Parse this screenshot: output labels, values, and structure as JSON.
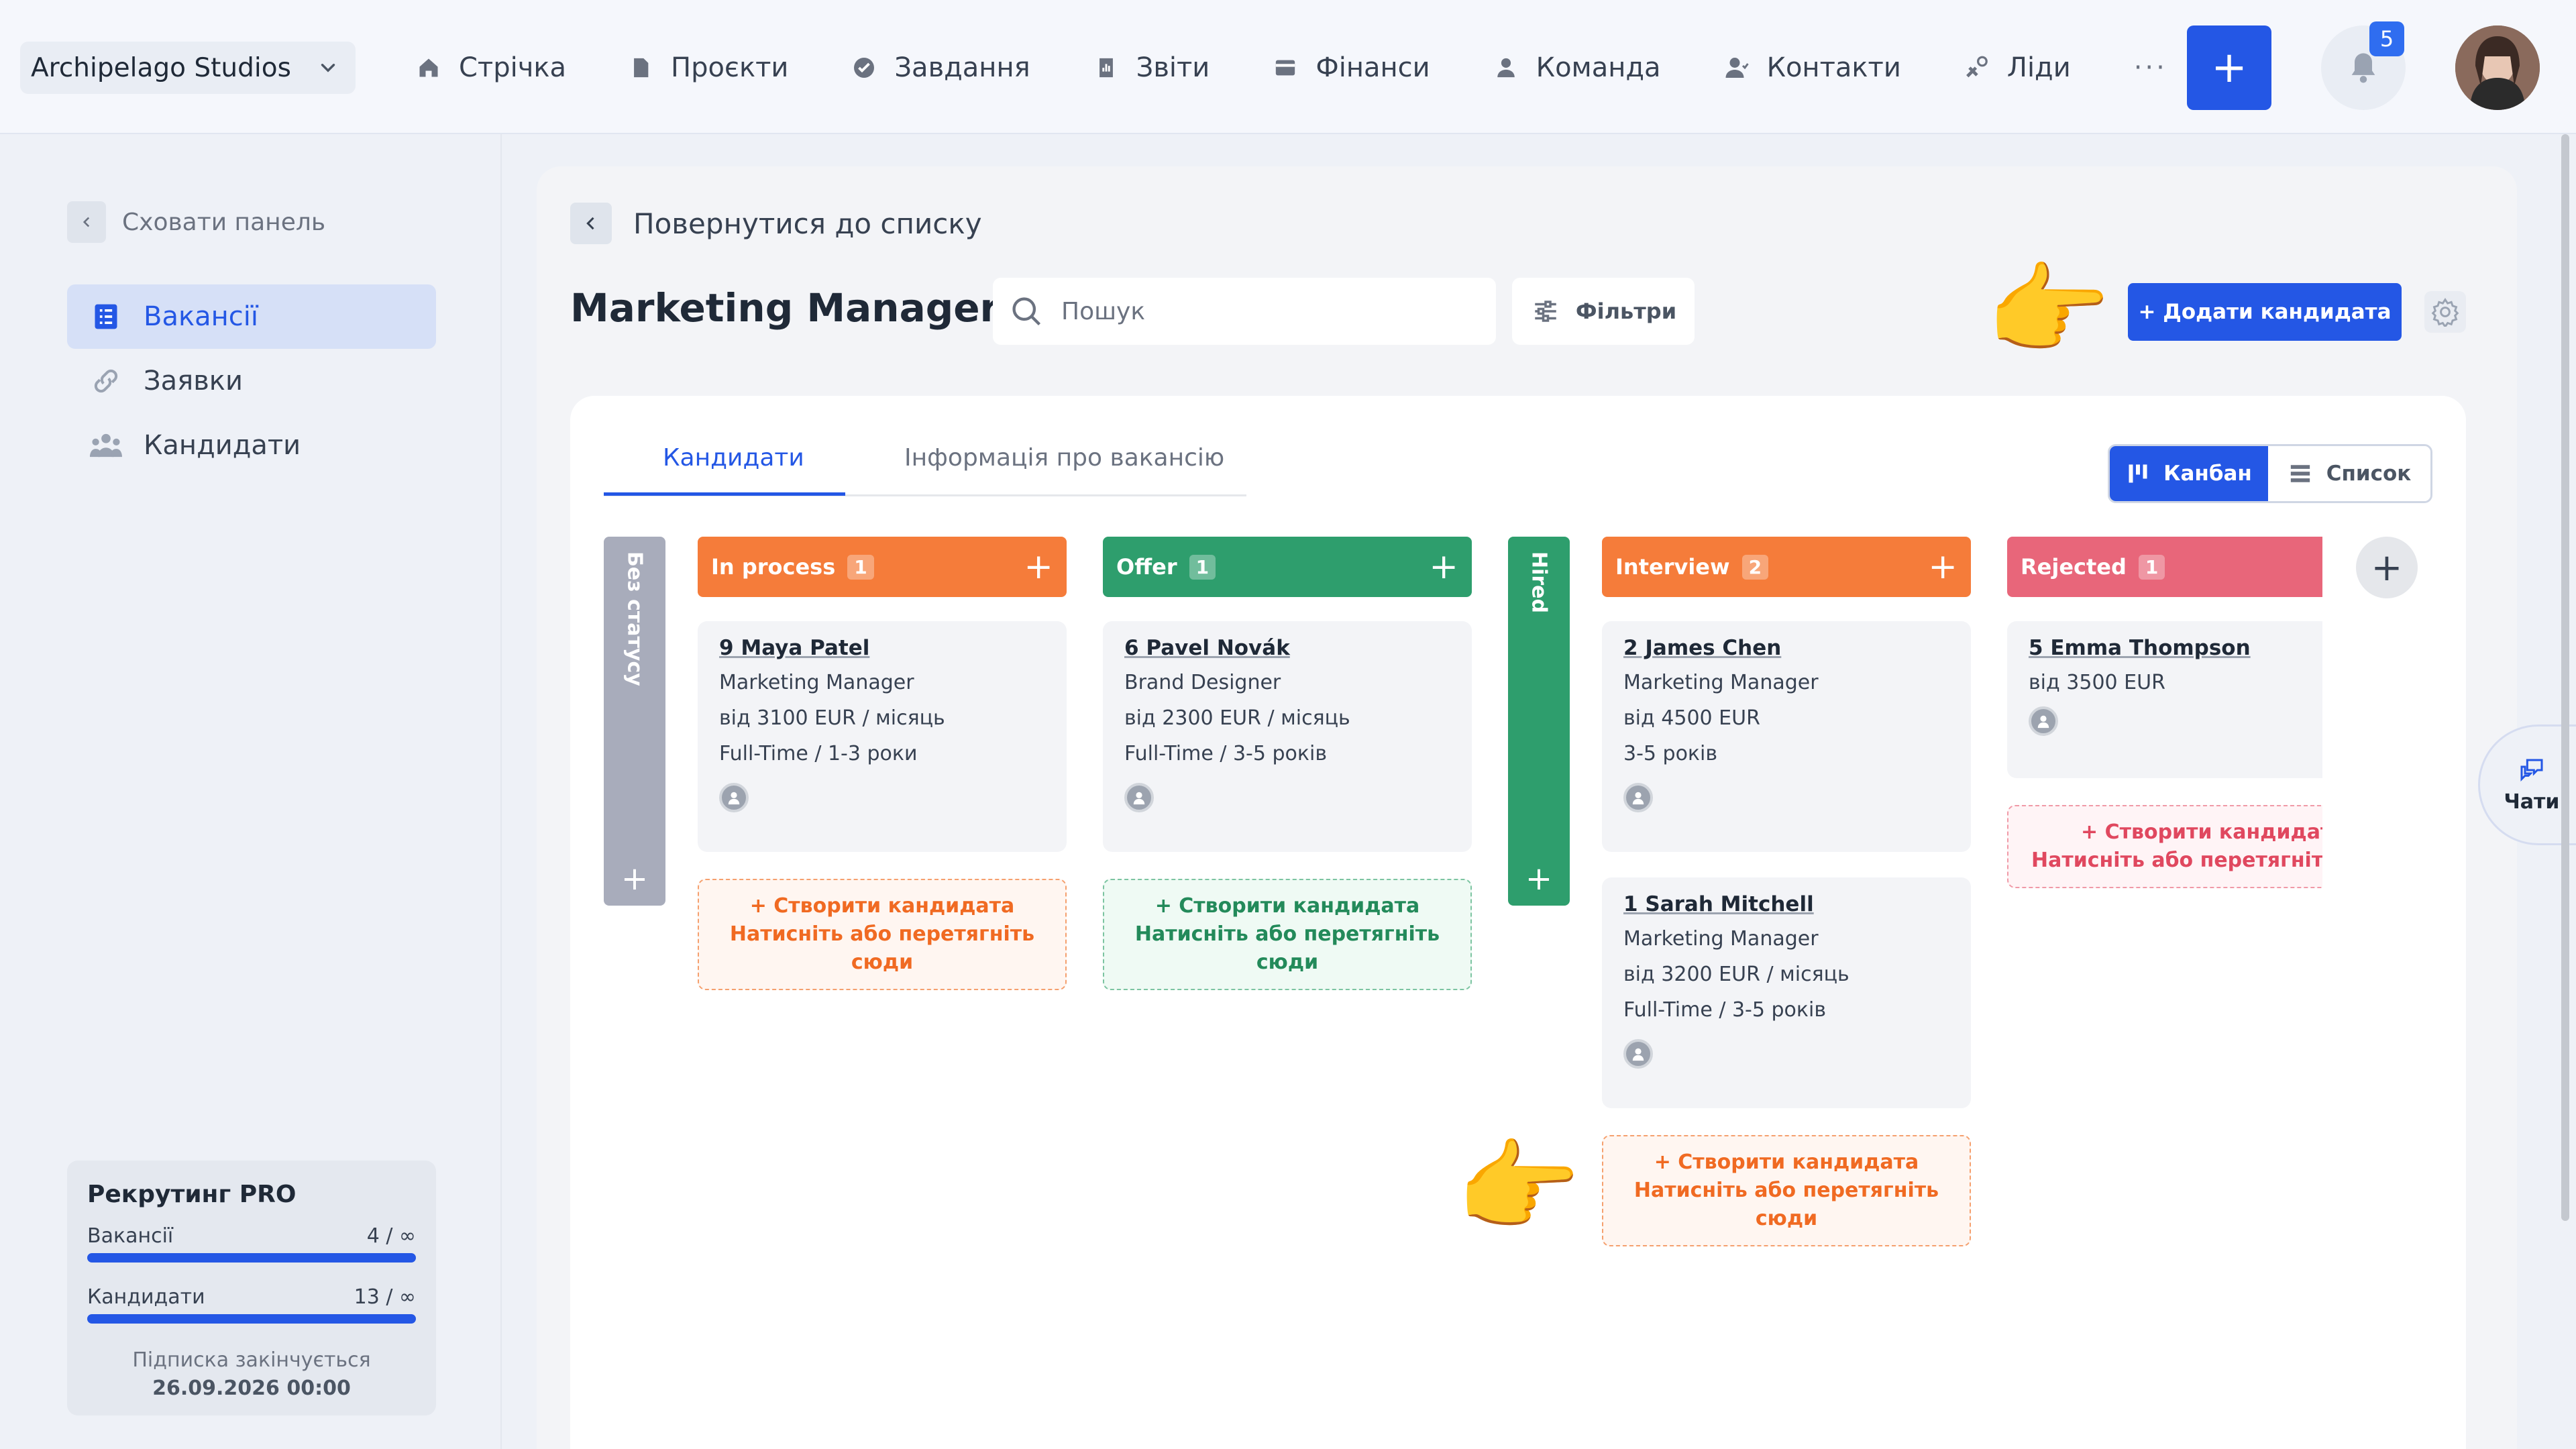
{
  "workspace": {
    "name": "Archipelago Studios"
  },
  "nav": [
    {
      "label": "Стрічка",
      "icon": "home-icon"
    },
    {
      "label": "Проєкти",
      "icon": "document-icon"
    },
    {
      "label": "Завдання",
      "icon": "check-circle-icon"
    },
    {
      "label": "Звіти",
      "icon": "report-icon"
    },
    {
      "label": "Фінанси",
      "icon": "wallet-icon"
    },
    {
      "label": "Команда",
      "icon": "person-icon"
    },
    {
      "label": "Контакти",
      "icon": "contacts-icon"
    },
    {
      "label": "Ліди",
      "icon": "leads-icon"
    }
  ],
  "nav_more": "···",
  "header": {
    "add_button": "+",
    "notifications_count": "5"
  },
  "sidebar": {
    "hide_label": "Сховати панель",
    "items": [
      {
        "label": "Вакансії",
        "icon": "list-icon",
        "active": true
      },
      {
        "label": "Заявки",
        "icon": "link-icon",
        "active": false
      },
      {
        "label": "Кандидати",
        "icon": "people-icon",
        "active": false
      }
    ],
    "plan": {
      "title": "Рекрутинг PRO",
      "vacancies_label": "Вакансії",
      "vacancies_value": "4 / ∞",
      "candidates_label": "Кандидати",
      "candidates_value": "13 / ∞",
      "expires_label": "Підписка закінчується",
      "expires_date": "26.09.2026 00:00"
    }
  },
  "main": {
    "back_label": "Повернутися до списку",
    "title": "Marketing Manager",
    "search_placeholder": "Пошук",
    "filters_label": "Фільтри",
    "add_candidate_label": "+ Додати кандидата",
    "tabs": [
      {
        "label": "Кандидати",
        "active": true
      },
      {
        "label": "Інформація про вакансію",
        "active": false
      }
    ],
    "views": [
      {
        "label": "Канбан",
        "active": true
      },
      {
        "label": "Список",
        "active": false
      }
    ],
    "plus": "+"
  },
  "kanban": {
    "no_status": {
      "label": "Без статусу",
      "color": "#a8acbb"
    },
    "hired": {
      "label": "Hired",
      "color": "#2e9e6d"
    },
    "columns": [
      {
        "name": "In process",
        "count": "1",
        "color": "#f57c3a",
        "cards": [
          {
            "title": "9 Maya Patel",
            "lines": [
              "Marketing Manager",
              "від 3100 EUR / місяць",
              "Full-Time / 1-3 роки"
            ]
          }
        ],
        "drop_line1": "+ Створити кандидата",
        "drop_line2": "Натисніть або перетягніть сюди"
      },
      {
        "name": "Offer",
        "count": "1",
        "color": "#2e9e6d",
        "cards": [
          {
            "title": "6 Pavel Novák",
            "lines": [
              "Brand Designer",
              "від 2300 EUR / місяць",
              "Full-Time / 3-5 років"
            ]
          }
        ],
        "drop_line1": "+ Створити кандидата",
        "drop_line2": "Натисніть або перетягніть сюди"
      },
      {
        "name": "Interview",
        "count": "2",
        "color": "#f57c3a",
        "cards": [
          {
            "title": "2 James Chen",
            "lines": [
              "Marketing Manager",
              "від 4500 EUR",
              "3-5 років"
            ]
          },
          {
            "title": "1 Sarah Mitchell",
            "lines": [
              "Marketing Manager",
              "від 3200 EUR / місяць",
              "Full-Time / 3-5 років"
            ]
          }
        ],
        "drop_line1": "+ Створити кандидата",
        "drop_line2": "Натисніть або перетягніть сюди"
      },
      {
        "name": "Rejected",
        "count": "1",
        "color": "#e8667a",
        "cards": [
          {
            "title": "5 Emma Thompson",
            "lines": [
              "від 3500 EUR"
            ]
          }
        ],
        "drop_line1": "+ Створити кандидата",
        "drop_line2": "Натисніть або перетягніть ск"
      }
    ]
  },
  "chat": {
    "label": "Чати"
  },
  "colors": {
    "accent": "#2457e5",
    "orange": "#f57c3a",
    "green": "#2e9e6d",
    "red": "#e8667a"
  }
}
